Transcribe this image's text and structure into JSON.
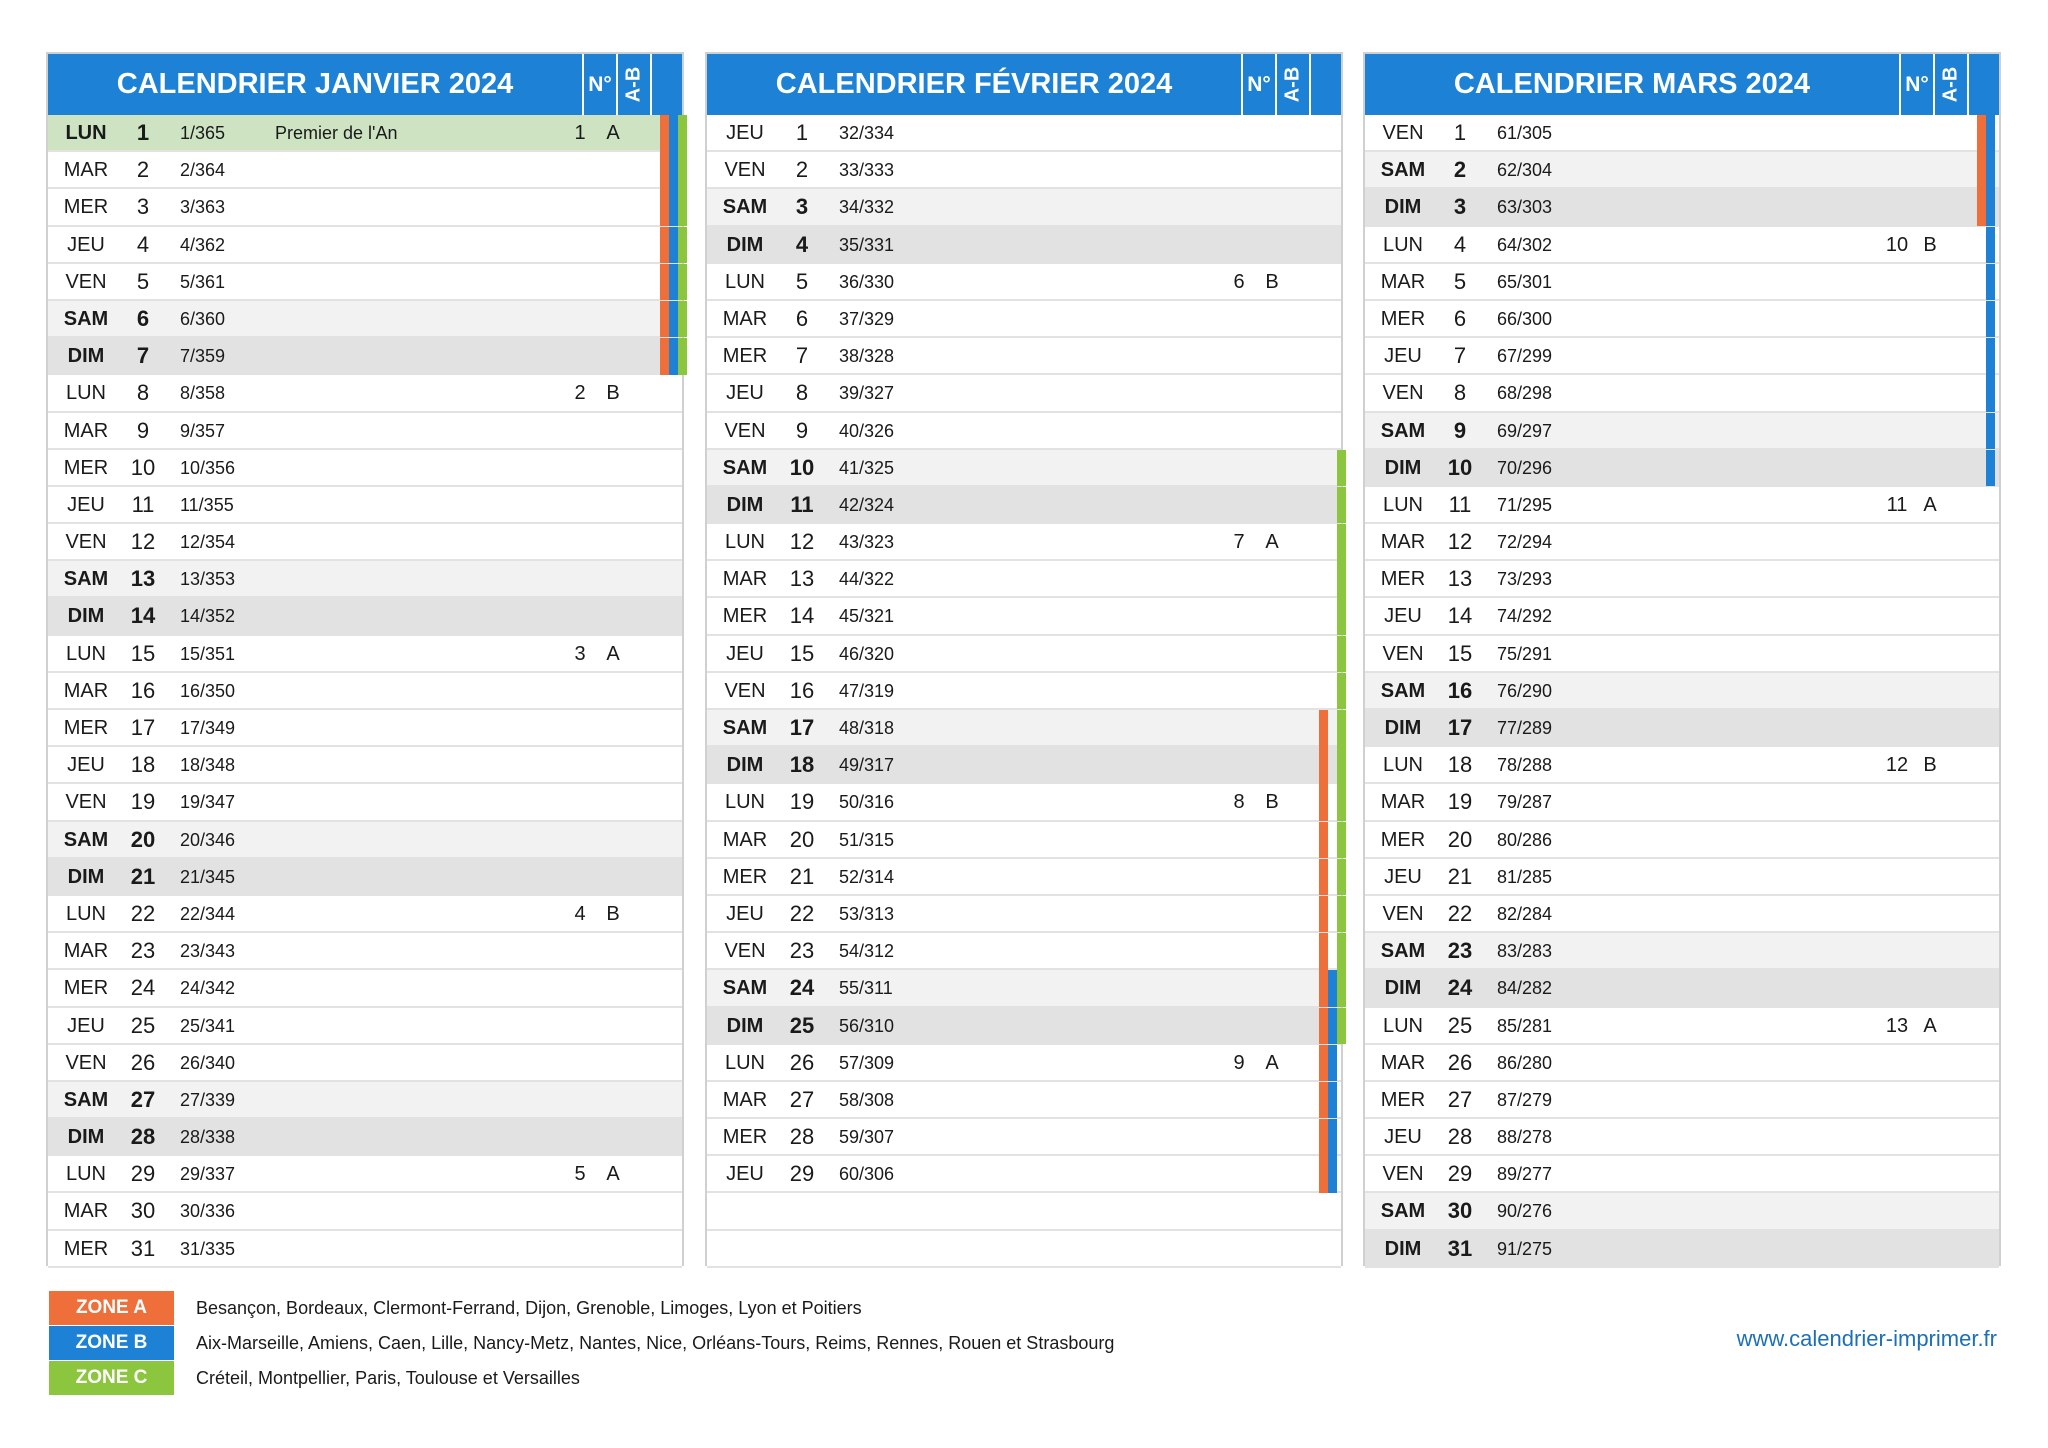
{
  "header_labels": {
    "week": "N°",
    "ab": "A-B"
  },
  "zone_colors": {
    "A": "#ef6f3a",
    "B": "#1d82d6",
    "C": "#8cc63f"
  },
  "row_colors": {
    "weekday": "#ffffff",
    "saturday": "#f2f2f2",
    "sunday": "#e2e2e2",
    "holiday": "#cde3c2"
  },
  "months": [
    {
      "title": "CALENDRIER JANVIER 2024",
      "days": [
        {
          "d": "LUN",
          "n": "1",
          "doy": "1/365",
          "event": "Premier de l'An",
          "week": "1",
          "ab": "A",
          "zones": [
            "A",
            "B",
            "C"
          ]
        },
        {
          "d": "MAR",
          "n": "2",
          "doy": "2/364",
          "zones": [
            "A",
            "B",
            "C"
          ]
        },
        {
          "d": "MER",
          "n": "3",
          "doy": "3/363",
          "zones": [
            "A",
            "B",
            "C"
          ]
        },
        {
          "d": "JEU",
          "n": "4",
          "doy": "4/362",
          "zones": [
            "A",
            "B",
            "C"
          ]
        },
        {
          "d": "VEN",
          "n": "5",
          "doy": "5/361",
          "zones": [
            "A",
            "B",
            "C"
          ]
        },
        {
          "d": "SAM",
          "n": "6",
          "doy": "6/360",
          "zones": [
            "A",
            "B",
            "C"
          ]
        },
        {
          "d": "DIM",
          "n": "7",
          "doy": "7/359",
          "zones": [
            "A",
            "B",
            "C"
          ]
        },
        {
          "d": "LUN",
          "n": "8",
          "doy": "8/358",
          "week": "2",
          "ab": "B"
        },
        {
          "d": "MAR",
          "n": "9",
          "doy": "9/357"
        },
        {
          "d": "MER",
          "n": "10",
          "doy": "10/356"
        },
        {
          "d": "JEU",
          "n": "11",
          "doy": "11/355"
        },
        {
          "d": "VEN",
          "n": "12",
          "doy": "12/354"
        },
        {
          "d": "SAM",
          "n": "13",
          "doy": "13/353"
        },
        {
          "d": "DIM",
          "n": "14",
          "doy": "14/352"
        },
        {
          "d": "LUN",
          "n": "15",
          "doy": "15/351",
          "week": "3",
          "ab": "A"
        },
        {
          "d": "MAR",
          "n": "16",
          "doy": "16/350"
        },
        {
          "d": "MER",
          "n": "17",
          "doy": "17/349"
        },
        {
          "d": "JEU",
          "n": "18",
          "doy": "18/348"
        },
        {
          "d": "VEN",
          "n": "19",
          "doy": "19/347"
        },
        {
          "d": "SAM",
          "n": "20",
          "doy": "20/346"
        },
        {
          "d": "DIM",
          "n": "21",
          "doy": "21/345"
        },
        {
          "d": "LUN",
          "n": "22",
          "doy": "22/344",
          "week": "4",
          "ab": "B"
        },
        {
          "d": "MAR",
          "n": "23",
          "doy": "23/343"
        },
        {
          "d": "MER",
          "n": "24",
          "doy": "24/342"
        },
        {
          "d": "JEU",
          "n": "25",
          "doy": "25/341"
        },
        {
          "d": "VEN",
          "n": "26",
          "doy": "26/340"
        },
        {
          "d": "SAM",
          "n": "27",
          "doy": "27/339"
        },
        {
          "d": "DIM",
          "n": "28",
          "doy": "28/338"
        },
        {
          "d": "LUN",
          "n": "29",
          "doy": "29/337",
          "week": "5",
          "ab": "A"
        },
        {
          "d": "MAR",
          "n": "30",
          "doy": "30/336"
        },
        {
          "d": "MER",
          "n": "31",
          "doy": "31/335"
        }
      ]
    },
    {
      "title": "CALENDRIER FÉVRIER 2024",
      "days": [
        {
          "d": "JEU",
          "n": "1",
          "doy": "32/334"
        },
        {
          "d": "VEN",
          "n": "2",
          "doy": "33/333"
        },
        {
          "d": "SAM",
          "n": "3",
          "doy": "34/332"
        },
        {
          "d": "DIM",
          "n": "4",
          "doy": "35/331"
        },
        {
          "d": "LUN",
          "n": "5",
          "doy": "36/330",
          "week": "6",
          "ab": "B"
        },
        {
          "d": "MAR",
          "n": "6",
          "doy": "37/329"
        },
        {
          "d": "MER",
          "n": "7",
          "doy": "38/328"
        },
        {
          "d": "JEU",
          "n": "8",
          "doy": "39/327"
        },
        {
          "d": "VEN",
          "n": "9",
          "doy": "40/326"
        },
        {
          "d": "SAM",
          "n": "10",
          "doy": "41/325",
          "zones": [
            "C"
          ]
        },
        {
          "d": "DIM",
          "n": "11",
          "doy": "42/324",
          "zones": [
            "C"
          ]
        },
        {
          "d": "LUN",
          "n": "12",
          "doy": "43/323",
          "week": "7",
          "ab": "A",
          "zones": [
            "C"
          ]
        },
        {
          "d": "MAR",
          "n": "13",
          "doy": "44/322",
          "zones": [
            "C"
          ]
        },
        {
          "d": "MER",
          "n": "14",
          "doy": "45/321",
          "zones": [
            "C"
          ]
        },
        {
          "d": "JEU",
          "n": "15",
          "doy": "46/320",
          "zones": [
            "C"
          ]
        },
        {
          "d": "VEN",
          "n": "16",
          "doy": "47/319",
          "zones": [
            "C"
          ]
        },
        {
          "d": "SAM",
          "n": "17",
          "doy": "48/318",
          "zones": [
            "A",
            "C"
          ]
        },
        {
          "d": "DIM",
          "n": "18",
          "doy": "49/317",
          "zones": [
            "A",
            "C"
          ]
        },
        {
          "d": "LUN",
          "n": "19",
          "doy": "50/316",
          "week": "8",
          "ab": "B",
          "zones": [
            "A",
            "C"
          ]
        },
        {
          "d": "MAR",
          "n": "20",
          "doy": "51/315",
          "zones": [
            "A",
            "C"
          ]
        },
        {
          "d": "MER",
          "n": "21",
          "doy": "52/314",
          "zones": [
            "A",
            "C"
          ]
        },
        {
          "d": "JEU",
          "n": "22",
          "doy": "53/313",
          "zones": [
            "A",
            "C"
          ]
        },
        {
          "d": "VEN",
          "n": "23",
          "doy": "54/312",
          "zones": [
            "A",
            "C"
          ]
        },
        {
          "d": "SAM",
          "n": "24",
          "doy": "55/311",
          "zones": [
            "A",
            "B",
            "C"
          ]
        },
        {
          "d": "DIM",
          "n": "25",
          "doy": "56/310",
          "zones": [
            "A",
            "B",
            "C"
          ]
        },
        {
          "d": "LUN",
          "n": "26",
          "doy": "57/309",
          "week": "9",
          "ab": "A",
          "zones": [
            "A",
            "B"
          ]
        },
        {
          "d": "MAR",
          "n": "27",
          "doy": "58/308",
          "zones": [
            "A",
            "B"
          ]
        },
        {
          "d": "MER",
          "n": "28",
          "doy": "59/307",
          "zones": [
            "A",
            "B"
          ]
        },
        {
          "d": "JEU",
          "n": "29",
          "doy": "60/306",
          "zones": [
            "A",
            "B"
          ]
        }
      ]
    },
    {
      "title": "CALENDRIER MARS 2024",
      "days": [
        {
          "d": "VEN",
          "n": "1",
          "doy": "61/305",
          "zones": [
            "A",
            "B"
          ]
        },
        {
          "d": "SAM",
          "n": "2",
          "doy": "62/304",
          "zones": [
            "A",
            "B"
          ]
        },
        {
          "d": "DIM",
          "n": "3",
          "doy": "63/303",
          "zones": [
            "A",
            "B"
          ]
        },
        {
          "d": "LUN",
          "n": "4",
          "doy": "64/302",
          "week": "10",
          "ab": "B",
          "zones": [
            "B"
          ]
        },
        {
          "d": "MAR",
          "n": "5",
          "doy": "65/301",
          "zones": [
            "B"
          ]
        },
        {
          "d": "MER",
          "n": "6",
          "doy": "66/300",
          "zones": [
            "B"
          ]
        },
        {
          "d": "JEU",
          "n": "7",
          "doy": "67/299",
          "zones": [
            "B"
          ]
        },
        {
          "d": "VEN",
          "n": "8",
          "doy": "68/298",
          "zones": [
            "B"
          ]
        },
        {
          "d": "SAM",
          "n": "9",
          "doy": "69/297",
          "zones": [
            "B"
          ]
        },
        {
          "d": "DIM",
          "n": "10",
          "doy": "70/296",
          "zones": [
            "B"
          ]
        },
        {
          "d": "LUN",
          "n": "11",
          "doy": "71/295",
          "week": "11",
          "ab": "A"
        },
        {
          "d": "MAR",
          "n": "12",
          "doy": "72/294"
        },
        {
          "d": "MER",
          "n": "13",
          "doy": "73/293"
        },
        {
          "d": "JEU",
          "n": "14",
          "doy": "74/292"
        },
        {
          "d": "VEN",
          "n": "15",
          "doy": "75/291"
        },
        {
          "d": "SAM",
          "n": "16",
          "doy": "76/290"
        },
        {
          "d": "DIM",
          "n": "17",
          "doy": "77/289"
        },
        {
          "d": "LUN",
          "n": "18",
          "doy": "78/288",
          "week": "12",
          "ab": "B"
        },
        {
          "d": "MAR",
          "n": "19",
          "doy": "79/287"
        },
        {
          "d": "MER",
          "n": "20",
          "doy": "80/286"
        },
        {
          "d": "JEU",
          "n": "21",
          "doy": "81/285"
        },
        {
          "d": "VEN",
          "n": "22",
          "doy": "82/284"
        },
        {
          "d": "SAM",
          "n": "23",
          "doy": "83/283"
        },
        {
          "d": "DIM",
          "n": "24",
          "doy": "84/282"
        },
        {
          "d": "LUN",
          "n": "25",
          "doy": "85/281",
          "week": "13",
          "ab": "A"
        },
        {
          "d": "MAR",
          "n": "26",
          "doy": "86/280"
        },
        {
          "d": "MER",
          "n": "27",
          "doy": "87/279"
        },
        {
          "d": "JEU",
          "n": "28",
          "doy": "88/278"
        },
        {
          "d": "VEN",
          "n": "29",
          "doy": "89/277"
        },
        {
          "d": "SAM",
          "n": "30",
          "doy": "90/276"
        },
        {
          "d": "DIM",
          "n": "31",
          "doy": "91/275"
        }
      ]
    }
  ],
  "legend": [
    {
      "zone": "A",
      "label": "ZONE A",
      "cities": "Besançon, Bordeaux, Clermont-Ferrand, Dijon, Grenoble, Limoges, Lyon et Poitiers"
    },
    {
      "zone": "B",
      "label": "ZONE B",
      "cities": "Aix-Marseille, Amiens, Caen, Lille, Nancy-Metz, Nantes, Nice, Orléans-Tours, Reims, Rennes, Rouen et Strasbourg"
    },
    {
      "zone": "C",
      "label": "ZONE C",
      "cities": "Créteil, Montpellier, Paris, Toulouse et Versailles"
    }
  ],
  "website": "www.calendrier-imprimer.fr"
}
